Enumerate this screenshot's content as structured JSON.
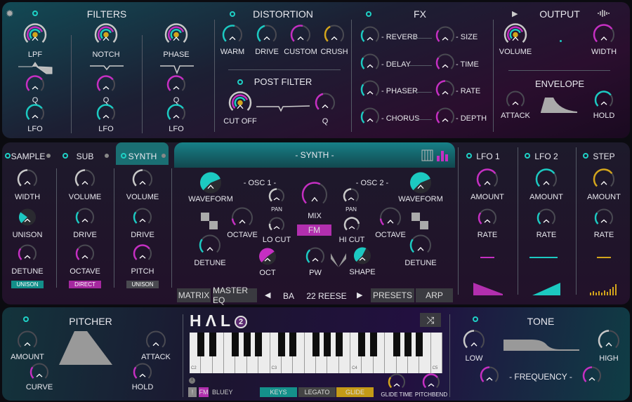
{
  "colors": {
    "teal": "#1cc9c1",
    "magenta": "#c52fc2",
    "yellow": "#d3a51c",
    "gray": "#c8c8c8",
    "track": "#4a4a52"
  },
  "filters": {
    "title": "FILTERS",
    "lpf": {
      "label": "LPF",
      "level": 0.75,
      "color": "multi"
    },
    "notch": {
      "label": "NOTCH",
      "level": 0.75,
      "color": "multi"
    },
    "phase": {
      "label": "PHASE",
      "level": 0.75,
      "color": "multi"
    },
    "q1": {
      "label": "Q",
      "level": 0.7,
      "color": "magenta"
    },
    "q2": {
      "label": "Q",
      "level": 0.7,
      "color": "magenta"
    },
    "q3": {
      "label": "Q",
      "level": 0.7,
      "color": "magenta"
    },
    "lfo1": {
      "label": "LFO",
      "level": 0.7,
      "color": "teal"
    },
    "lfo2": {
      "label": "LFO",
      "level": 0.7,
      "color": "teal"
    },
    "lfo3": {
      "label": "LFO",
      "level": 0.7,
      "color": "teal"
    }
  },
  "distortion": {
    "title": "DISTORTION",
    "warm": {
      "label": "WARM",
      "level": 0.55,
      "color": "teal"
    },
    "drive": {
      "label": "DRIVE",
      "level": 0.45,
      "color": "teal"
    },
    "custom": {
      "label": "CUSTOM",
      "level": 0.55,
      "color": "magenta"
    },
    "crush": {
      "label": "CRUSH",
      "level": 0.4,
      "color": "yellow"
    }
  },
  "post_filter": {
    "title": "POST FILTER",
    "cutoff": {
      "label": "CUT OFF",
      "level": 0.75,
      "color": "multi"
    },
    "q": {
      "label": "Q",
      "level": 0.45,
      "color": "magenta"
    }
  },
  "fx": {
    "title": "FX",
    "reverb": {
      "label": "REVERB",
      "level": 0.3,
      "color": "teal"
    },
    "delay": {
      "label": "DELAY",
      "level": 0.3,
      "color": "teal"
    },
    "phaser": {
      "label": "PHASER",
      "level": 0.3,
      "color": "teal"
    },
    "chorus": {
      "label": "CHORUS",
      "level": 0.3,
      "color": "teal"
    },
    "size": {
      "label": "SIZE",
      "level": 0.3,
      "color": "magenta"
    },
    "time": {
      "label": "TIME",
      "level": 0.3,
      "color": "magenta"
    },
    "rate": {
      "label": "RATE",
      "level": 0.5,
      "color": "magenta"
    },
    "depth": {
      "label": "DEPTH",
      "level": 0.3,
      "color": "magenta"
    }
  },
  "output": {
    "title": "OUTPUT",
    "volume": {
      "label": "VOLUME",
      "level": 0.75,
      "color": "multi"
    },
    "width": {
      "label": "WIDTH",
      "level": 0.7,
      "color": "magenta"
    }
  },
  "envelope": {
    "title": "ENVELOPE",
    "attack": {
      "label": "ATTACK",
      "level": 0.0,
      "color": "teal"
    },
    "hold": {
      "label": "HOLD",
      "level": 0.7,
      "color": "teal"
    }
  },
  "tabs": {
    "sample": "SAMPLE",
    "sub": "SUB",
    "synth": "SYNTH",
    "lfo1": "LFO 1",
    "lfo2": "LFO 2",
    "step": "STEP"
  },
  "sample": {
    "width": {
      "label": "WIDTH",
      "level": 0.5,
      "color": "gray"
    },
    "unison": {
      "label": "UNISON",
      "level": 0.3,
      "color": "teal",
      "filled": true
    },
    "detune": {
      "label": "DETUNE",
      "level": 0.3,
      "color": "magenta"
    },
    "badge": "UNISON"
  },
  "sub": {
    "volume": {
      "label": "VOLUME",
      "level": 0.5,
      "color": "gray"
    },
    "drive": {
      "label": "DRIVE",
      "level": 0.3,
      "color": "teal"
    },
    "octave": {
      "label": "OCTAVE",
      "level": 0.3,
      "color": "magenta"
    },
    "badge": "DIRECT"
  },
  "synth_tab": {
    "volume": {
      "label": "VOLUME",
      "level": 0.5,
      "color": "gray"
    },
    "drive": {
      "label": "DRIVE",
      "level": 0.3,
      "color": "teal"
    },
    "pitch": {
      "label": "PITCH",
      "level": 0.7,
      "color": "magenta"
    },
    "badge": "UNISON"
  },
  "synth": {
    "title": "- SYNTH -",
    "osc1": "- OSC 1 -",
    "osc2": "- OSC 2 -",
    "wave1": {
      "label": "WAVEFORM",
      "level": 0.75,
      "color": "teal",
      "filled": true
    },
    "wave2": {
      "label": "WAVEFORM",
      "level": 0.75,
      "color": "teal",
      "filled": true
    },
    "pan1": {
      "label": "PAN",
      "level": 0.5,
      "color": "gray"
    },
    "pan2": {
      "label": "PAN",
      "level": 0.5,
      "color": "gray"
    },
    "mix": {
      "label": "MIX",
      "level": 0.6,
      "color": "magenta"
    },
    "fm": "FM",
    "oct1": {
      "label": "OCTAVE",
      "level": 0.15,
      "color": "magenta"
    },
    "oct2": {
      "label": "OCTAVE",
      "level": 0.15,
      "color": "magenta"
    },
    "locut": {
      "label": "LO CUT",
      "level": 0.2,
      "color": "gray"
    },
    "hicut": {
      "label": "HI CUT",
      "level": 0.8,
      "color": "gray"
    },
    "det1": {
      "label": "DETUNE",
      "level": 0.3,
      "color": "teal"
    },
    "det2": {
      "label": "DETUNE",
      "level": 0.3,
      "color": "teal"
    },
    "oct": {
      "label": "OCT",
      "level": 0.7,
      "color": "magenta",
      "filled": true
    },
    "pw": {
      "label": "PW",
      "level": 0.35,
      "color": "teal"
    },
    "shape": {
      "label": "SHAPE",
      "level": 0.6,
      "color": "teal",
      "filled": true
    }
  },
  "bottom_bar": {
    "matrix": "MATRIX",
    "master_eq": "MASTER EQ",
    "bank": "BA",
    "preset": "22 REESE",
    "presets": "PRESETS",
    "arp": "ARP"
  },
  "lfo1": {
    "amount": {
      "label": "AMOUNT",
      "level": 0.7,
      "color": "magenta"
    },
    "rate": {
      "label": "RATE",
      "level": 0.3,
      "color": "magenta"
    }
  },
  "lfo2": {
    "amount": {
      "label": "AMOUNT",
      "level": 0.7,
      "color": "teal"
    },
    "rate": {
      "label": "RATE",
      "level": 0.3,
      "color": "teal"
    }
  },
  "step": {
    "amount": {
      "label": "AMOUNT",
      "level": 0.7,
      "color": "yellow"
    },
    "rate": {
      "label": "RATE",
      "level": 0.3,
      "color": "teal"
    }
  },
  "pitcher": {
    "title": "PITCHER",
    "amount": {
      "label": "AMOUNT",
      "level": 0.0,
      "color": "teal"
    },
    "attack": {
      "label": "ATTACK",
      "level": 0.0,
      "color": "teal"
    },
    "curve": {
      "label": "CURVE",
      "level": 0.3,
      "color": "magenta"
    },
    "hold": {
      "label": "HOLD",
      "level": 0.3,
      "color": "magenta"
    }
  },
  "logo": "HALO 2",
  "keyboard": {
    "labels": [
      "C2",
      "C3",
      "C4",
      "C5"
    ]
  },
  "footer": {
    "warn": "!",
    "fm": "FM",
    "author": "BLUEY",
    "keys": "KEYS",
    "legato": "LEGATO",
    "glide": "GLIDE",
    "glide_time": {
      "label": "GLIDE TIME",
      "level": 0.3,
      "color": "yellow"
    },
    "pitchbend": {
      "label": "PITCHBEND",
      "level": 0.7,
      "color": "magenta"
    }
  },
  "tone": {
    "title": "TONE",
    "low": {
      "label": "LOW",
      "level": 0.5,
      "color": "gray"
    },
    "high": {
      "label": "HIGH",
      "level": 0.5,
      "color": "gray"
    },
    "frequency": "- FREQUENCY -",
    "freq1": {
      "level": 0.5,
      "color": "magenta"
    },
    "freq2": {
      "level": 0.5,
      "color": "magenta"
    }
  }
}
